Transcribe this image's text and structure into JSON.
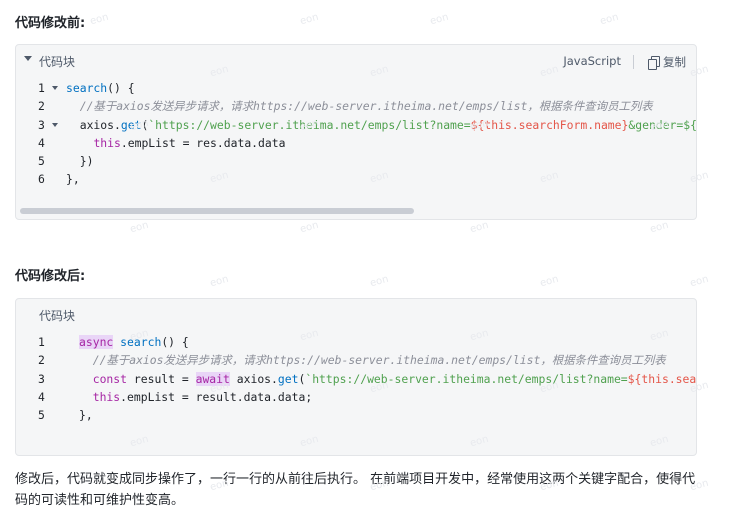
{
  "before": {
    "heading": "代码修改前:",
    "block_title": "代码块",
    "language": "JavaScript",
    "copy_label": "复制",
    "lines": [
      {
        "no": "1",
        "html": "<span class=\"fn\">search</span>() {"
      },
      {
        "no": "2",
        "html": "  <span class=\"cm\">//基于axios发送异步请求，请求https://web-server.itheima.net/emps/list，根据条件查询员工列表</span>"
      },
      {
        "no": "3",
        "html": "  axios.<span class=\"fn\">get</span>(<span class=\"str\">`https://web-server.itheima.net/emps/list?name=</span><span class=\"tmpl\">${this.searchForm.name}</span><span class=\"str\">&amp;gender=${t</span>"
      },
      {
        "no": "4",
        "html": "    <span class=\"kw\">this</span>.empList = res.data.data"
      },
      {
        "no": "5",
        "html": "  })"
      },
      {
        "no": "6",
        "html": "},"
      }
    ]
  },
  "after": {
    "heading": "代码修改后:",
    "block_title": "代码块",
    "lines": [
      {
        "no": "1",
        "html": "<span class=\"kw hl\">async</span> <span class=\"fn\">search</span>() {"
      },
      {
        "no": "2",
        "html": "  <span class=\"cm\">//基于axios发送异步请求，请求https://web-server.itheima.net/emps/list，根据条件查询员工列表</span>"
      },
      {
        "no": "3",
        "html": "  <span class=\"kw\">const</span> result = <span class=\"kw hl\">await</span> axios.<span class=\"fn\">get</span>(<span class=\"str\">`https://web-server.itheima.net/emps/list?name=</span><span class=\"tmpl\">${this.searc</span>"
      },
      {
        "no": "4",
        "html": "  <span class=\"kw\">this</span>.empList = result.data.data;"
      },
      {
        "no": "5",
        "html": "},"
      }
    ]
  },
  "paragraph": "修改后，代码就变成同步操作了，一行一行的从前往后执行。 在前端项目开发中，经常使用这两个关键字配合，使得代码的可读性和可维护性变高。",
  "watermark_text": "eon"
}
